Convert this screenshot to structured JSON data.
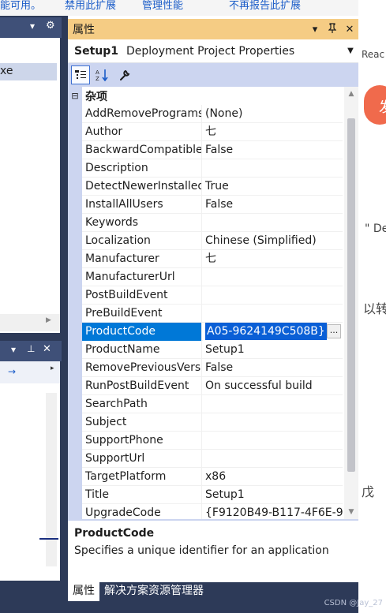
{
  "background": {
    "top_links": [
      "能可用。",
      "禁用此扩展",
      "管理性能",
      "不再报告此扩展"
    ],
    "left_panel_item": "xe",
    "right_texts": [
      "Reac",
      "发",
      "\" De",
      "以转",
      "戊"
    ]
  },
  "window": {
    "title": "属性",
    "controls": {
      "dropdown": "▾",
      "pin": "📌",
      "close": "✕"
    }
  },
  "object": {
    "name": "Setup1",
    "type": "Deployment Project Properties"
  },
  "toolbar": {
    "categorized": "categorized-icon",
    "alphabetical": "alphabetical-icon",
    "property_pages": "wrench-icon"
  },
  "category": {
    "toggle": "⊟",
    "label": "杂项"
  },
  "properties": [
    {
      "name": "AddRemoveProgramsIcon",
      "value": "(None)"
    },
    {
      "name": "Author",
      "value": "七"
    },
    {
      "name": "BackwardCompatibleIDGeneration",
      "value": "False"
    },
    {
      "name": "Description",
      "value": ""
    },
    {
      "name": "DetectNewerInstalledVersion",
      "value": "True"
    },
    {
      "name": "InstallAllUsers",
      "value": "False"
    },
    {
      "name": "Keywords",
      "value": ""
    },
    {
      "name": "Localization",
      "value": "Chinese (Simplified)"
    },
    {
      "name": "Manufacturer",
      "value": "七"
    },
    {
      "name": "ManufacturerUrl",
      "value": ""
    },
    {
      "name": "PostBuildEvent",
      "value": ""
    },
    {
      "name": "PreBuildEvent",
      "value": ""
    },
    {
      "name": "ProductCode",
      "value": "A05-9624149C508B}",
      "selected": true
    },
    {
      "name": "ProductName",
      "value": "Setup1"
    },
    {
      "name": "RemovePreviousVersions",
      "value": "False"
    },
    {
      "name": "RunPostBuildEvent",
      "value": "On successful build"
    },
    {
      "name": "SearchPath",
      "value": ""
    },
    {
      "name": "Subject",
      "value": ""
    },
    {
      "name": "SupportPhone",
      "value": ""
    },
    {
      "name": "SupportUrl",
      "value": ""
    },
    {
      "name": "TargetPlatform",
      "value": "x86"
    },
    {
      "name": "Title",
      "value": "Setup1"
    },
    {
      "name": "UpgradeCode",
      "value": "{F9120B49-B117-4F6E-9"
    }
  ],
  "ellipsis_label": "...",
  "description": {
    "title": "ProductCode",
    "text": "Specifies a unique identifier for an application"
  },
  "tabs": [
    {
      "label": "属性",
      "active": true
    },
    {
      "label": "解决方案资源管理器",
      "active": false
    }
  ],
  "watermark": "CSDN @Jay_27",
  "colors": {
    "title_bar": "#f5cc84",
    "selection": "#0078d7",
    "toolbar": "#ccd5f0",
    "ide_frame": "#2d3a58"
  }
}
